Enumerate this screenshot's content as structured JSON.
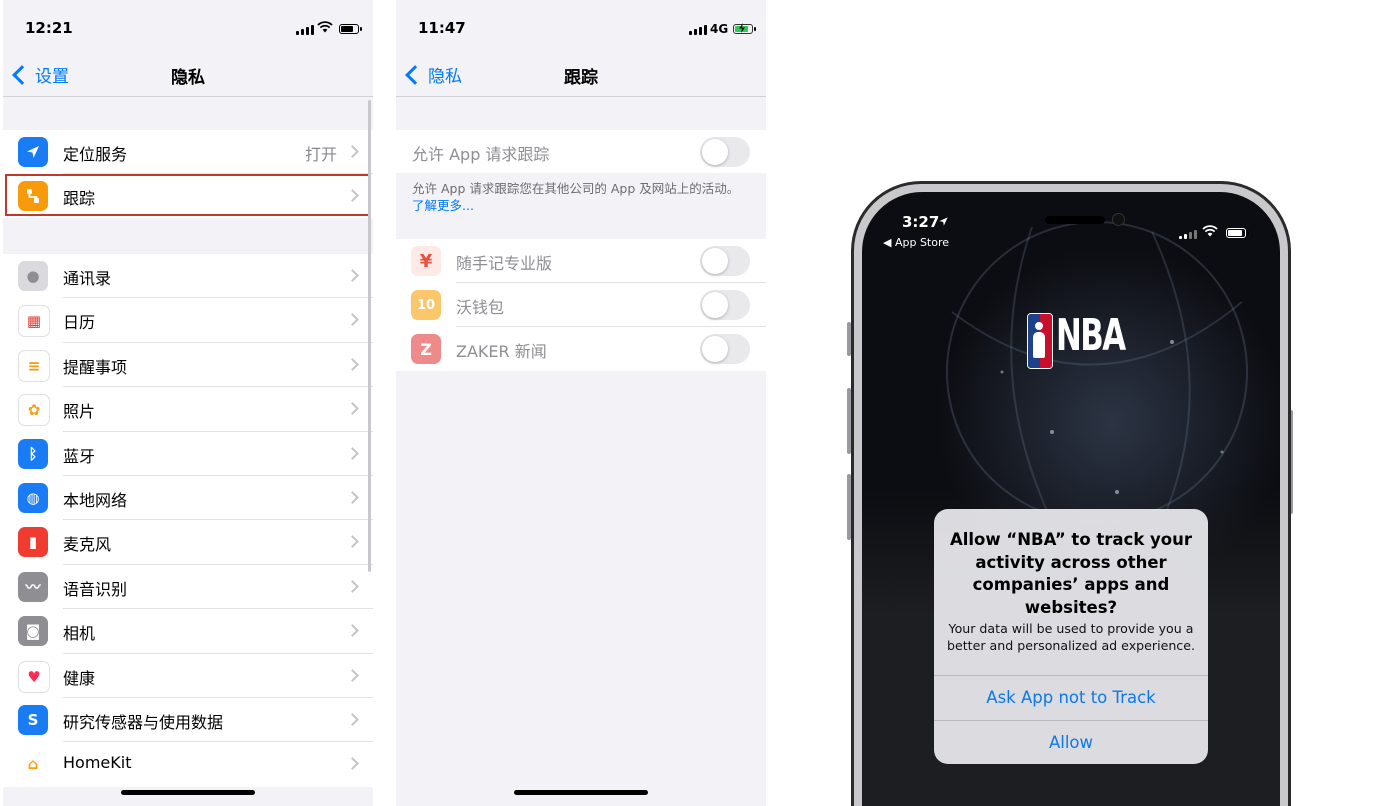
{
  "left_screen": {
    "status_time": "12:21",
    "back_label": "设置",
    "title": "隐私",
    "location_row": {
      "label": "定位服务",
      "value": "打开"
    },
    "tracking_row": {
      "label": "跟踪"
    },
    "items": [
      {
        "label": "通讯录",
        "icon": "contacts-icon"
      },
      {
        "label": "日历",
        "icon": "calendar-icon"
      },
      {
        "label": "提醒事项",
        "icon": "reminders-icon"
      },
      {
        "label": "照片",
        "icon": "photos-icon"
      },
      {
        "label": "蓝牙",
        "icon": "bluetooth-icon"
      },
      {
        "label": "本地网络",
        "icon": "globe-icon"
      },
      {
        "label": "麦克风",
        "icon": "microphone-icon"
      },
      {
        "label": "语音识别",
        "icon": "speech-recognition-icon"
      },
      {
        "label": "相机",
        "icon": "camera-icon"
      },
      {
        "label": "健康",
        "icon": "health-icon"
      },
      {
        "label": "研究传感器与使用数据",
        "icon": "research-icon"
      },
      {
        "label": "HomeKit",
        "icon": "home-icon"
      }
    ]
  },
  "middle_screen": {
    "status_time": "11:47",
    "network": "4G",
    "back_label": "隐私",
    "title": "跟踪",
    "allow_label": "允许 App 请求跟踪",
    "allow_on": false,
    "description": "允许 App 请求跟踪您在其他公司的 App 及网站上的活动。",
    "learn_more": "了解更多...",
    "apps": [
      {
        "name": "随手记专业版",
        "on": false
      },
      {
        "name": "沃钱包",
        "on": false
      },
      {
        "name": "ZAKER 新闻",
        "on": false
      }
    ]
  },
  "right_phone": {
    "status_time": "3:27",
    "back_app": "◀ App Store",
    "logo_text": "NBA",
    "dialog": {
      "title": "Allow “NBA” to track your activity across other companies’ apps and websites?",
      "message": "Your data will be used to provide you a better and personalized ad experience.",
      "deny_button": "Ask App not to Track",
      "allow_button": "Allow"
    }
  },
  "colors": {
    "ios_blue": "#007aff",
    "highlight_red": "#c0392b",
    "grouped_bg": "#f2f2f7"
  }
}
